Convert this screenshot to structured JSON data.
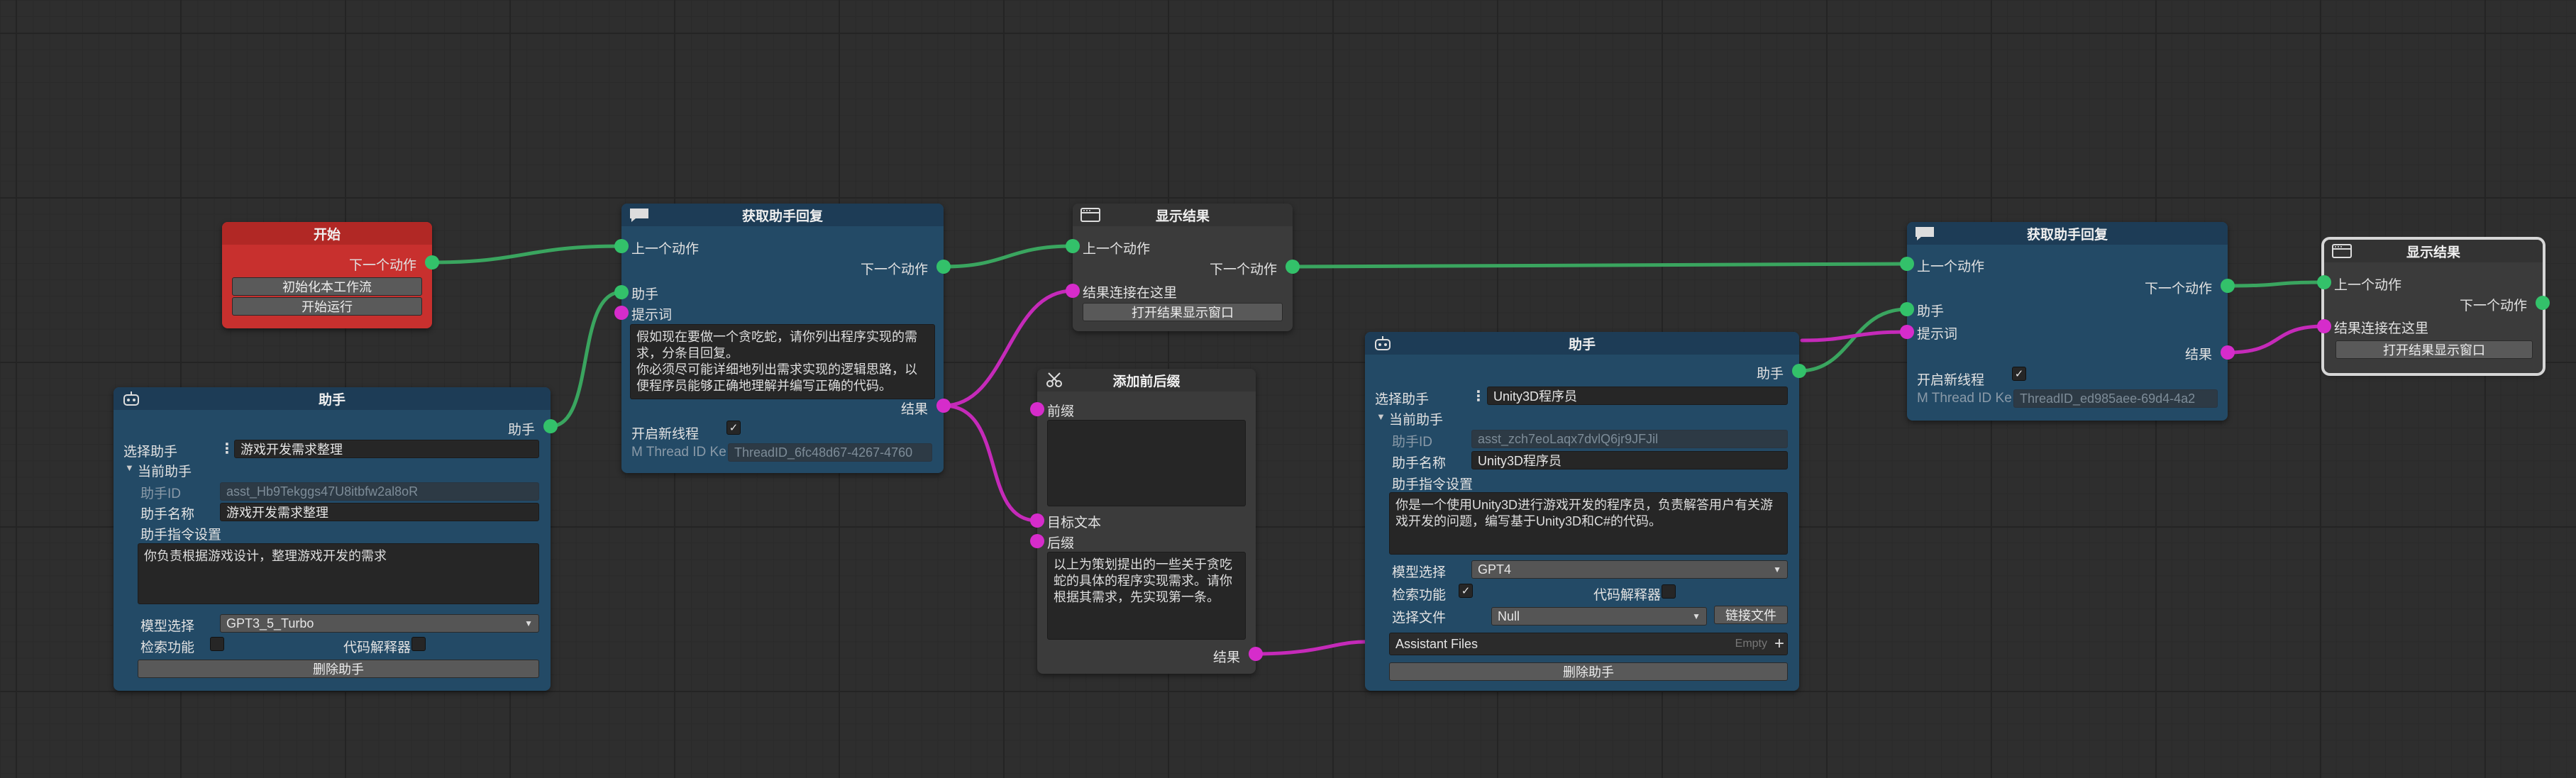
{
  "start_node": {
    "title": "开始",
    "next_action": "下一个动作",
    "btn_init": "初始化本工作流",
    "btn_run": "开始运行"
  },
  "assistant1": {
    "title": "助手",
    "out": "助手",
    "select_label": "选择助手",
    "select_value": "游戏开发需求整理",
    "current_label": "当前助手",
    "id_label": "助手ID",
    "id_value": "asst_Hb9Tekggs47U8itbfw2al8oR",
    "name_label": "助手名称",
    "name_value": "游戏开发需求整理",
    "instr_label": "助手指令设置",
    "instr_value": "你负责根据游戏设计，整理游戏开发的需求",
    "model_label": "模型选择",
    "model_value": "GPT3_5_Turbo",
    "search_label": "检索功能",
    "code_label": "代码解释器",
    "delete_btn": "删除助手"
  },
  "get_reply1": {
    "title": "获取助手回复",
    "prev": "上一个动作",
    "next": "下一个动作",
    "assistant": "助手",
    "prompt": "提示词",
    "prompt_text": "假如现在要做一个贪吃蛇，请你列出程序实现的需求，分条目回复。\n你必须尽可能详细地列出需求实现的逻辑思路，以便程序员能够正确地理解并编写正确的代码。",
    "result": "结果",
    "new_thread": "开启新线程",
    "thread_label": "M Thread ID Ke",
    "thread_value": "ThreadID_6fc48d67-4267-4760"
  },
  "display1": {
    "title": "显示结果",
    "prev": "上一个动作",
    "next": "下一个动作",
    "result_here": "结果连接在这里",
    "open_btn": "打开结果显示窗口"
  },
  "prefix_suffix": {
    "title": "添加前后缀",
    "prefix": "前缀",
    "target": "目标文本",
    "suffix": "后缀",
    "suffix_text": "以上为策划提出的一些关于贪吃蛇的具体的程序实现需求。请你根据其需求，先实现第一条。",
    "result": "结果"
  },
  "assistant2": {
    "title": "助手",
    "out": "助手",
    "select_label": "选择助手",
    "select_value": "Unity3D程序员",
    "current_label": "当前助手",
    "id_label": "助手ID",
    "id_value": "asst_zch7eoLaqx7dvlQ6jr9JFJil",
    "name_label": "助手名称",
    "name_value": "Unity3D程序员",
    "instr_label": "助手指令设置",
    "instr_value": "你是一个使用Unity3D进行游戏开发的程序员，负责解答用户有关游戏开发的问题，编写基于Unity3D和C#的代码。",
    "model_label": "模型选择",
    "model_value": "GPT4",
    "search_label": "检索功能",
    "code_label": "代码解释器",
    "file_label": "选择文件",
    "file_value": "Null",
    "link_btn": "链接文件",
    "files_title": "Assistant Files",
    "files_empty": "Empty",
    "plus": "+",
    "delete_btn": "删除助手"
  },
  "get_reply2": {
    "title": "获取助手回复",
    "prev": "上一个动作",
    "next": "下一个动作",
    "assistant": "助手",
    "prompt": "提示词",
    "result": "结果",
    "new_thread": "开启新线程",
    "thread_label": "M Thread ID Ke",
    "thread_value": "ThreadID_ed985aee-69d4-4a2"
  },
  "display2": {
    "title": "显示结果",
    "prev": "上一个动作",
    "next": "下一个动作",
    "result_here": "结果连接在这里",
    "open_btn": "打开结果显示窗口"
  },
  "checkmark": "✓",
  "colors": {
    "flow": "#33c16a",
    "data": "#d62ccb",
    "start": "#c8302e",
    "node_blue": "#234a66",
    "node_gray": "#3b3b3b"
  }
}
